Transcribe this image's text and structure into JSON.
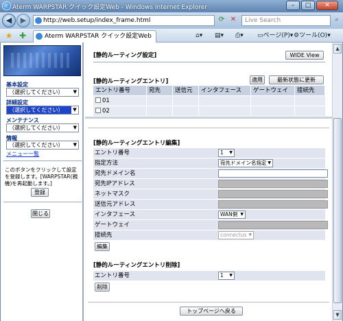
{
  "window": {
    "title": "Aterm WARPSTAR クイック設定Web - Windows Internet Explorer",
    "minimize": "–",
    "maximize": "□",
    "close": "✕"
  },
  "address_bar": {
    "url": "http://web.setup/index_frame.html",
    "search_placeholder": "Live Search"
  },
  "tab_bar": {
    "tab_title": "Aterm WARPSTAR クイック設定Web",
    "page_menu": "ページ(P)",
    "tools_menu": "ツール(O)"
  },
  "sidebar": {
    "sections": [
      {
        "label": "基本設定",
        "select": "（選択してください）",
        "highlighted": false
      },
      {
        "label": "詳細設定",
        "select": "（選択してください）",
        "highlighted": true
      },
      {
        "label": "メンテナンス",
        "select": "（選択してください）",
        "highlighted": false
      },
      {
        "label": "情報",
        "select": "（選択してください）",
        "highlighted": false
      }
    ],
    "menu_list_link": "メニュー一覧",
    "note": "このボタンをクリックして設定を登録します。[WARPSTAR(親機)を再起動します。]",
    "register_button": "登録",
    "close_button": "閉じる"
  },
  "main": {
    "page_title": "[静的ルーティング設定]",
    "wide_view_button": "WIDE View",
    "entry_section_title": "[静的ルーティングエントリ]",
    "apply_button": "適用",
    "refresh_button": "最新状態に更新",
    "table_headers": [
      "エントリ番号",
      "宛先",
      "送信元",
      "インタフェース",
      "ゲートウェイ",
      "接続先"
    ],
    "table_rows": [
      "01",
      "02"
    ],
    "edit_section_title": "[静的ルーティングエントリ編集]",
    "edit_fields": {
      "entry_number_label": "エントリ番号",
      "entry_number_value": "1",
      "method_label": "指定方法",
      "method_value": "宛先ドメイン名指定",
      "dest_domain_label": "宛先ドメイン名",
      "dest_ip_label": "宛先IPアドレス",
      "netmask_label": "ネットマスク",
      "src_ip_label": "送信元アドレス",
      "interface_label": "インタフェース",
      "interface_value": "WAN側",
      "gateway_label": "ゲートウェイ",
      "connection_label": "接続先",
      "connection_value": "connectus"
    },
    "edit_button": "編集",
    "delete_section_title": "[静的ルーティングエントリ削除]",
    "delete_entry_label": "エントリ番号",
    "delete_entry_value": "1",
    "delete_button": "削除",
    "top_page_button": "トップページへ戻る"
  }
}
